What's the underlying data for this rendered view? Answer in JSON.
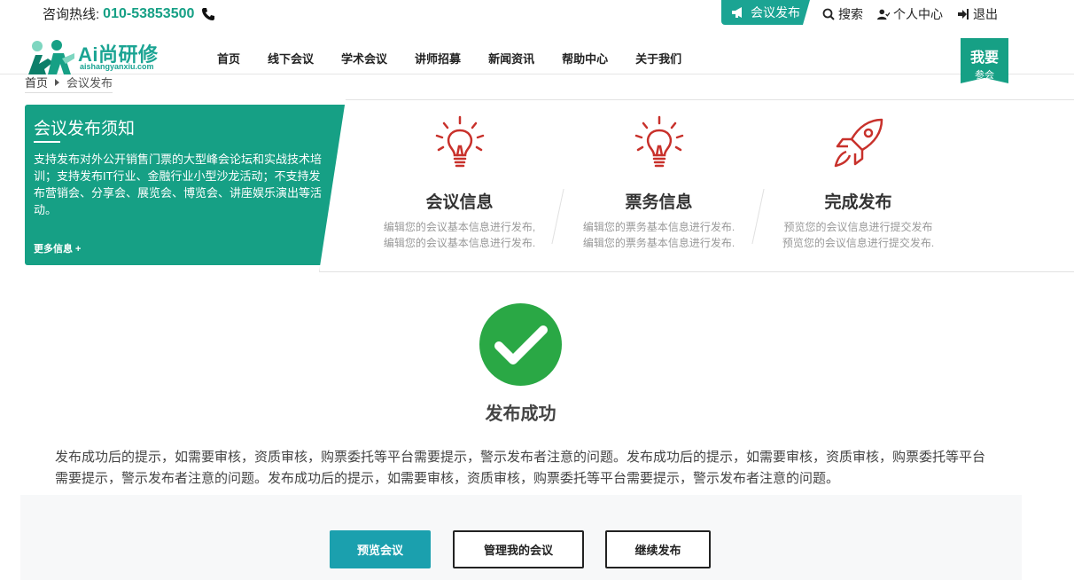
{
  "topbar": {
    "hotline_label": "咨询热线:",
    "hotline_number": "010-53853500",
    "publish_tab": "会议发布",
    "links": [
      {
        "label": "搜索",
        "icon": "search-icon"
      },
      {
        "label": "个人中心",
        "icon": "user-icon"
      },
      {
        "label": "退出",
        "icon": "logout-icon"
      }
    ]
  },
  "logo": {
    "name": "Ai尚研修",
    "domain": "aishangyanxiu.com"
  },
  "nav": {
    "items": [
      "首页",
      "线下会议",
      "学术会议",
      "讲师招募",
      "新闻资讯",
      "帮助中心",
      "关于我们"
    ],
    "join_line1": "我要",
    "join_line2": "参会"
  },
  "breadcrumb": {
    "home": "首页",
    "current": "会议发布"
  },
  "notice": {
    "title": "会议发布须知",
    "body": "支持发布对外公开销售门票的大型峰会论坛和实战技术培训；支持发布IT行业、金融行业小型沙龙活动；不支持发布营销会、分享会、展览会、博览会、讲座娱乐演出等活动。",
    "more": "更多信息 +"
  },
  "steps": [
    {
      "icon": "lightbulb-icon",
      "title": "会议信息",
      "desc_line1": "编辑您的会议基本信息进行发布,",
      "desc_line2": "编辑您的会议基本信息进行发布."
    },
    {
      "icon": "lightbulb-icon",
      "title": "票务信息",
      "desc_line1": "编辑您的票务基本信息进行发布.",
      "desc_line2": "编辑您的票务基本信息进行发布."
    },
    {
      "icon": "rocket-icon",
      "title": "完成发布",
      "desc_line1": "预览您的会议信息进行提交发布",
      "desc_line2": "预览您的会议信息进行提交发布."
    }
  ],
  "success": {
    "title": "发布成功",
    "text": "发布成功后的提示，如需要审核，资质审核，购票委托等平台需要提示，警示发布者注意的问题。发布成功后的提示，如需要审核，资质审核，购票委托等平台需要提示，警示发布者注意的问题。发布成功后的提示，如需要审核，资质审核，购票委托等平台需要提示，警示发布者注意的问题。"
  },
  "actions": {
    "preview": "预览会议",
    "manage": "管理我的会议",
    "continue": "继续发布"
  },
  "colors": {
    "brand": "#16a085",
    "accent_red": "#c8312b",
    "success_green": "#2aa845",
    "button_teal": "#1ba0ae"
  }
}
